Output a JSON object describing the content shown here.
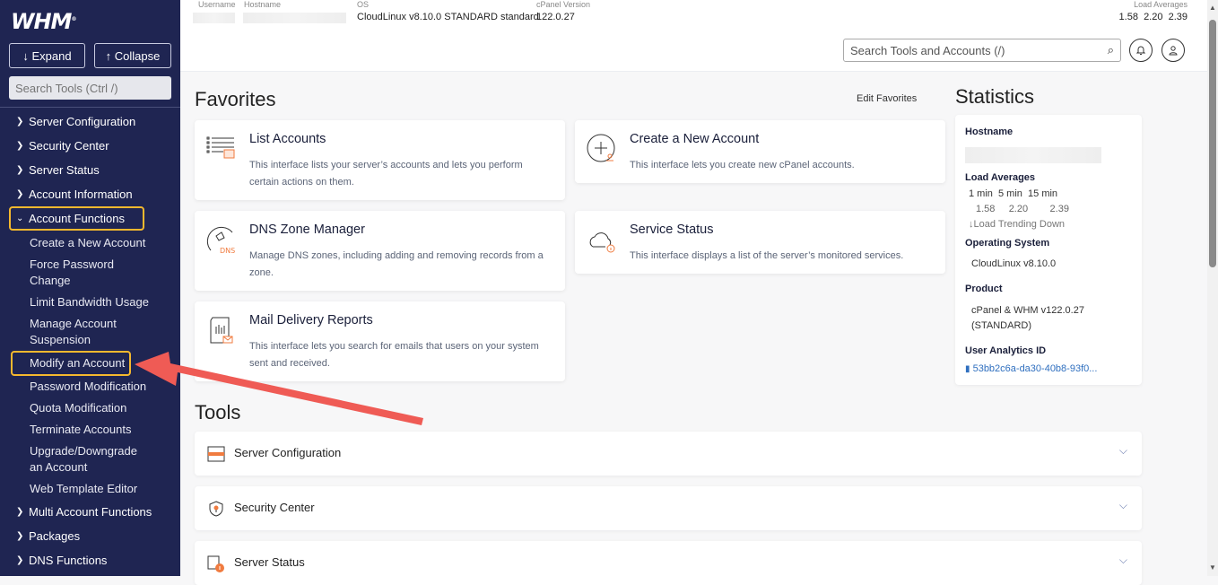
{
  "sidebar": {
    "logo": "WHM",
    "expand_label": "↓ Expand",
    "collapse_label": "↑ Collapse",
    "search_placeholder": "Search Tools (Ctrl /)",
    "items_before": [
      {
        "label": "Server Configuration"
      },
      {
        "label": "Security Center"
      },
      {
        "label": "Server Status"
      },
      {
        "label": "Account Information"
      }
    ],
    "open_item": {
      "label": "Account Functions",
      "highlighted": true
    },
    "sub_items": [
      {
        "label": "Create a New Account"
      },
      {
        "label": "Force Password Change"
      },
      {
        "label": "Limit Bandwidth Usage"
      },
      {
        "label": "Manage Account Suspension"
      },
      {
        "label": "Modify an Account",
        "highlighted": true
      },
      {
        "label": "Password Modification"
      },
      {
        "label": "Quota Modification"
      },
      {
        "label": "Terminate Accounts"
      },
      {
        "label": "Upgrade/Downgrade an Account"
      },
      {
        "label": "Web Template Editor"
      }
    ],
    "items_after": [
      {
        "label": "Multi Account Functions"
      },
      {
        "label": "Packages"
      },
      {
        "label": "DNS Functions"
      }
    ]
  },
  "topbar": {
    "username_label": "Username",
    "hostname_label": "Hostname",
    "os_label": "OS",
    "os_value": "CloudLinux v8.10.0 STANDARD standard",
    "cpanel_version_label": "cPanel Version",
    "cpanel_version_value": "122.0.27",
    "load_label": "Load Averages",
    "load_value": "1.58  2.20  2.39",
    "search_placeholder": "Search Tools and Accounts (/)"
  },
  "favorites": {
    "title": "Favorites",
    "edit_label": "Edit Favorites",
    "cards": [
      {
        "title": "List Accounts",
        "desc": "This interface lists your server’s accounts and lets you perform certain actions on them."
      },
      {
        "title": "Create a New Account",
        "desc": "This interface lets you create new cPanel accounts."
      },
      {
        "title": "DNS Zone Manager",
        "desc": "Manage DNS zones, including adding and removing records from a zone."
      },
      {
        "title": "Service Status",
        "desc": "This interface displays a list of the server’s monitored services."
      },
      {
        "title": "Mail Delivery Reports",
        "desc": "This interface lets you search for emails that users on your system sent and received."
      }
    ]
  },
  "statistics": {
    "title": "Statistics",
    "hostname_label": "Hostname",
    "load_label": "Load Averages",
    "load_headers": "1 min  5 min  15 min",
    "load_values": "1.58     2.20        2.39",
    "load_trend": "Load Trending Down",
    "os_label": "Operating System",
    "os_value": "CloudLinux v8.10.0",
    "product_label": "Product",
    "product_value": "cPanel & WHM v122.0.27 (STANDARD)",
    "analytics_label": "User Analytics ID",
    "analytics_value": "53bb2c6a-da30-40b8-93f0..."
  },
  "tools": {
    "title": "Tools",
    "rows": [
      {
        "label": "Server Configuration"
      },
      {
        "label": "Security Center"
      },
      {
        "label": "Server Status"
      }
    ]
  },
  "colors": {
    "sidebar_bg": "#1f2552",
    "highlight": "#f5b82e",
    "arrow": "#ef5b55",
    "accent_orange": "#f07b3f"
  }
}
